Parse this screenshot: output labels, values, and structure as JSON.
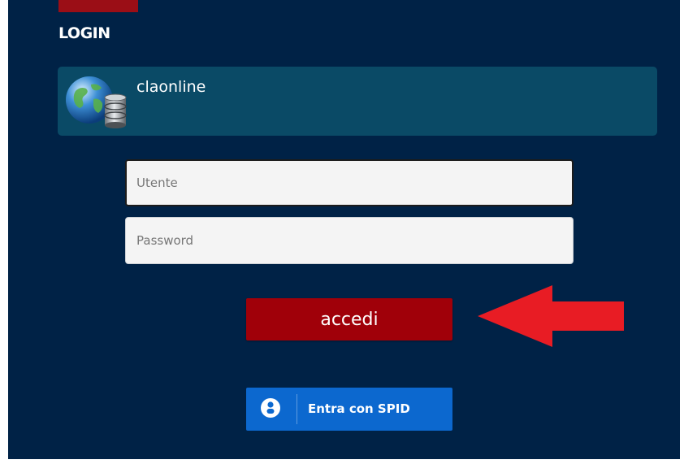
{
  "header": {
    "title": "LOGIN"
  },
  "profile": {
    "name": "claonline",
    "icon": "globe-database-icon"
  },
  "form": {
    "username": {
      "placeholder": "Utente",
      "value": ""
    },
    "password": {
      "placeholder": "Password",
      "value": ""
    }
  },
  "buttons": {
    "submit_label": "accedi",
    "spid_label": "Entra con SPID"
  },
  "annotation": {
    "icon": "red-arrow-left-icon"
  },
  "colors": {
    "panel_bg": "#002246",
    "card_bg": "#0a4a66",
    "accent_red": "#a00009",
    "spid_blue": "#0c68cf",
    "arrow_red": "#e81c24"
  }
}
